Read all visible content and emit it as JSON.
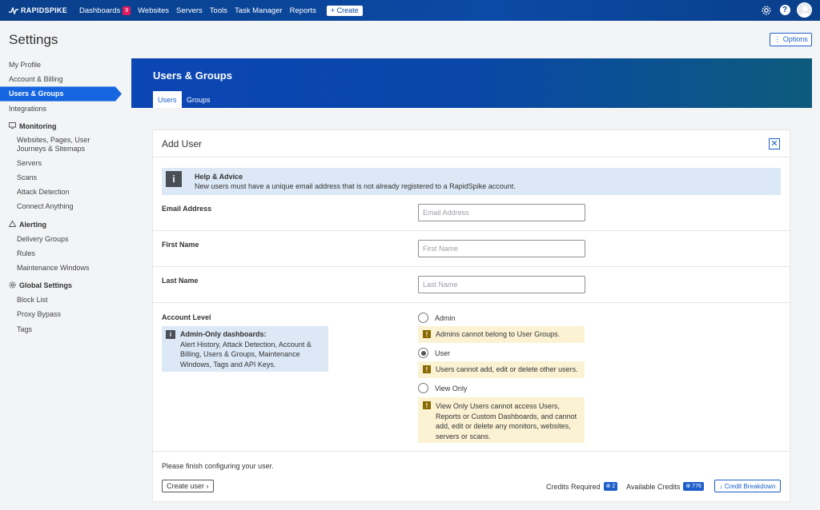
{
  "nav": {
    "logo": "RAPIDSPIKE",
    "items": [
      {
        "label": "Dashboards",
        "badge": "9"
      },
      {
        "label": "Websites"
      },
      {
        "label": "Servers"
      },
      {
        "label": "Tools"
      },
      {
        "label": "Task Manager"
      },
      {
        "label": "Reports"
      }
    ],
    "create_label": "+ Create",
    "help_label": "?",
    "icons": [
      "gear-icon",
      "help-icon",
      "avatar"
    ]
  },
  "page": {
    "title": "Settings",
    "options_label": "⋮ Options"
  },
  "sidebar": {
    "top_items": [
      "My Profile",
      "Account & Billing",
      "Users & Groups",
      "Integrations"
    ],
    "active": "Users & Groups",
    "sections": [
      {
        "title": "Monitoring",
        "icon": "monitor-icon",
        "items": [
          "Websites, Pages, User Journeys & Sitemaps",
          "Servers",
          "Scans",
          "Attack Detection",
          "Connect Anything"
        ]
      },
      {
        "title": "Alerting",
        "icon": "warning-icon",
        "items": [
          "Delivery Groups",
          "Rules",
          "Maintenance Windows"
        ]
      },
      {
        "title": "Global Settings",
        "icon": "gear-icon",
        "items": [
          "Block List",
          "Proxy Bypass",
          "Tags"
        ]
      }
    ]
  },
  "hero": {
    "title": "Users & Groups",
    "tabs": [
      "Users",
      "Groups"
    ],
    "active_tab": "Users"
  },
  "form": {
    "title": "Add User",
    "close_label": "✕",
    "advice": {
      "icon": "i",
      "title": "Help & Advice",
      "text": "New users must have a unique email address that is not already registered to a RapidSpike account."
    },
    "email": {
      "label": "Email Address",
      "placeholder": "Email Address",
      "value": ""
    },
    "first_name": {
      "label": "First Name",
      "placeholder": "First Name",
      "value": ""
    },
    "last_name": {
      "label": "Last Name",
      "placeholder": "Last Name",
      "value": ""
    },
    "account_level": {
      "label": "Account Level",
      "info_title": "Admin-Only dashboards:",
      "info_text": "Alert History, Attack Detection, Account & Billing, Users & Groups, Maintenance Windows, Tags and API Keys.",
      "options": [
        {
          "label": "Admin",
          "checked": false,
          "note": "Admins cannot belong to User Groups."
        },
        {
          "label": "User",
          "checked": true,
          "note": "Users cannot add, edit or delete other users."
        },
        {
          "label": "View Only",
          "checked": false,
          "note": "View Only Users cannot access Users, Reports or Custom Dashboards, and cannot add, edit or delete any monitors, websites, servers or scans."
        }
      ]
    },
    "footer_msg": "Please finish configuring your user.",
    "create_label": "Create user ›",
    "credits_required_label": "Credits Required",
    "credits_required": "⊕ 2",
    "available_credits_label": "Available Credits",
    "available_credits": "⊕ 776",
    "breakdown_label": "↓ Credit Breakdown"
  },
  "colors": {
    "nav_bg": "#0b4aa6",
    "accent": "#1566e0",
    "badge": "#e2195b",
    "info_bg": "#dce8f6",
    "warn_bg": "#fbf2d4"
  }
}
